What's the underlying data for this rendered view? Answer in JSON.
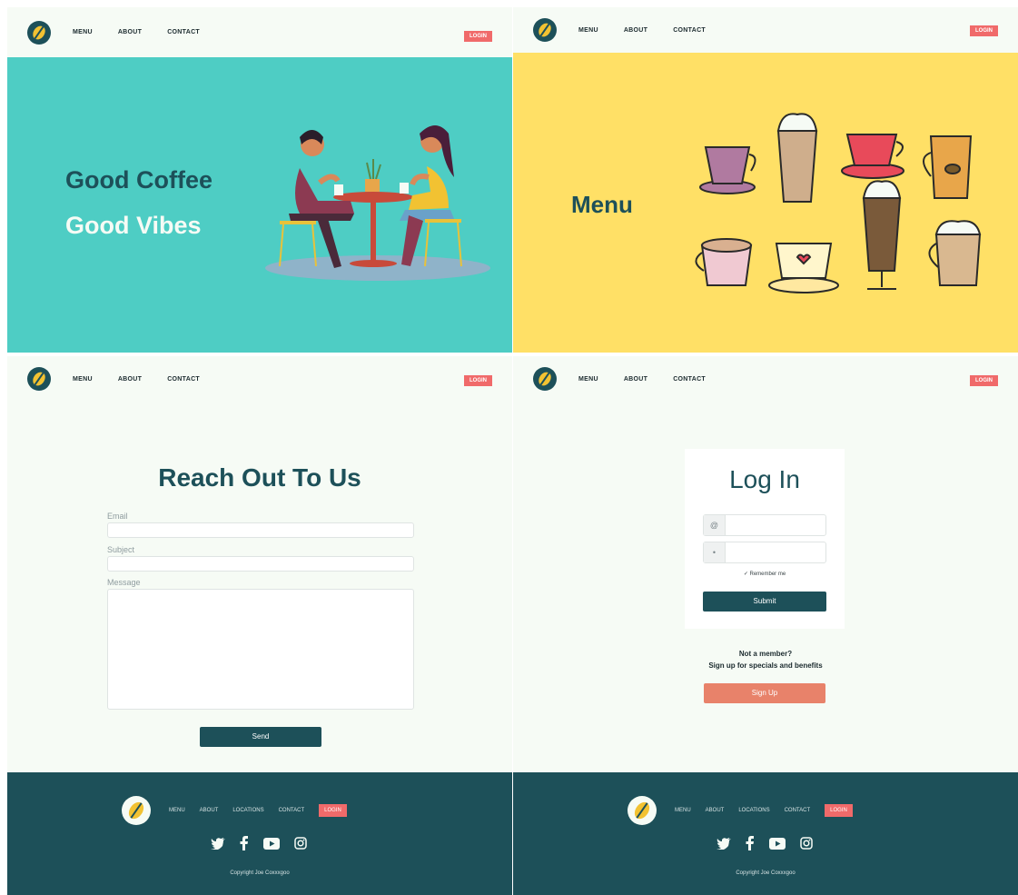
{
  "nav": {
    "links": [
      "MENU",
      "ABOUT",
      "CONTACT"
    ],
    "login_label": "LOGIN"
  },
  "home": {
    "headline_1": "Good Coffee",
    "headline_2": "Good Vibes"
  },
  "menu_page": {
    "title": "Menu"
  },
  "contact": {
    "title": "Reach Out To Us",
    "email_label": "Email",
    "subject_label": "Subject",
    "message_label": "Message",
    "send_label": "Send"
  },
  "login": {
    "title": "Log In",
    "email_icon": "@",
    "password_icon": "•",
    "remember_label": "✓ Remember me",
    "submit_label": "Submit",
    "member_question": "Not a member?",
    "member_pitch": "Sign up for specials and benefits",
    "signup_label": "Sign Up"
  },
  "footer": {
    "links": [
      "MENU",
      "ABOUT",
      "LOCATIONS",
      "CONTACT"
    ],
    "login_label": "LOGIN",
    "copyright": "Copyright Joe Coxxxgoo"
  },
  "colors": {
    "primary": "#1d5059",
    "teal": "#4ecdc4",
    "yellow": "#ffe066",
    "accent": "#f06a6a",
    "signup": "#e8826a",
    "background": "#f6fbf5"
  },
  "icons": [
    "coffee-bean-logo-icon",
    "twitter-icon",
    "facebook-icon",
    "youtube-icon",
    "instagram-icon"
  ]
}
